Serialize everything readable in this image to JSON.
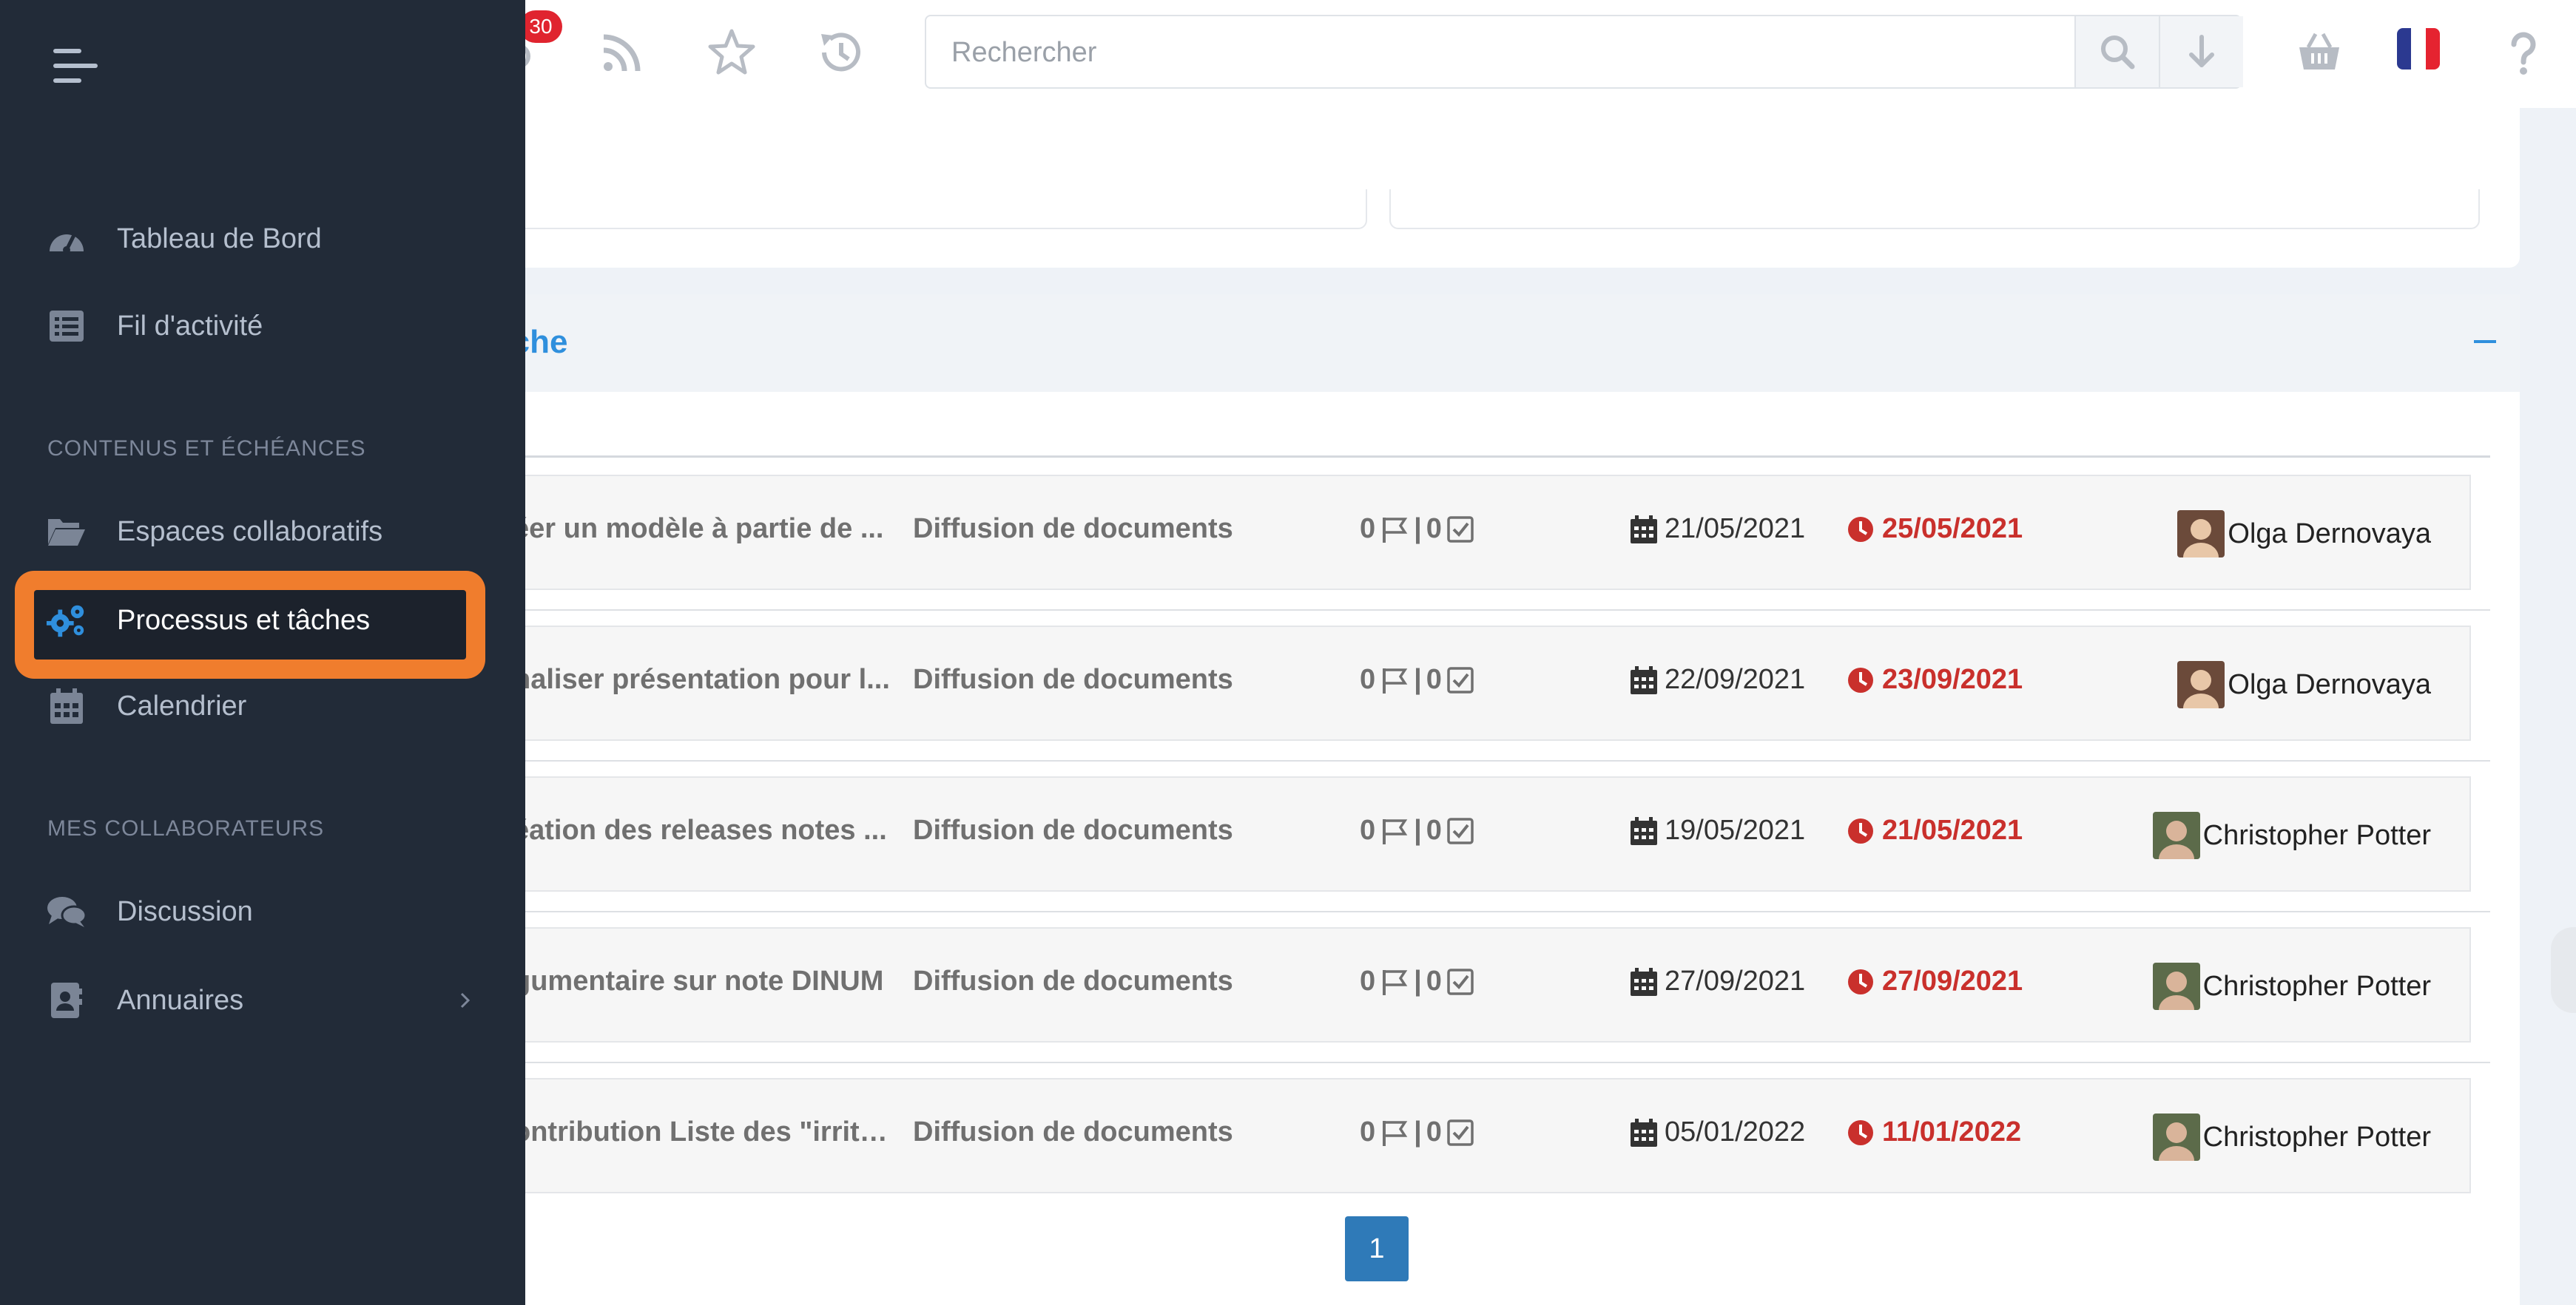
{
  "topbar": {
    "notification_count": "30",
    "search_placeholder": "Rechercher"
  },
  "section": {
    "title": "erche"
  },
  "sidebar": {
    "items_main": [
      {
        "label": "Tableau de Bord",
        "icon": "dashboard-icon"
      },
      {
        "label": "Fil d'activité",
        "icon": "list-icon"
      }
    ],
    "section_content": "CONTENUS ET ÉCHÉANCES",
    "items_content": [
      {
        "label": "Espaces collaboratifs",
        "icon": "folder-open-icon"
      },
      {
        "label": "Processus et tâches",
        "icon": "cogs-icon",
        "active": true
      },
      {
        "label": "Calendrier",
        "icon": "calendar-icon"
      }
    ],
    "section_collab": "MES COLLABORATEURS",
    "items_collab": [
      {
        "label": "Discussion",
        "icon": "comments-icon"
      },
      {
        "label": "Annuaires",
        "icon": "address-book-icon"
      }
    ]
  },
  "tasks": [
    {
      "title": "éer un modèle à partie de ...",
      "space": "Diffusion de documents",
      "flags": "0",
      "checks": "0",
      "start": "21/05/2021",
      "due": "25/05/2021",
      "user": "Olga Dernovaya"
    },
    {
      "title": "naliser présentation pour l...",
      "space": "Diffusion de documents",
      "flags": "0",
      "checks": "0",
      "start": "22/09/2021",
      "due": "23/09/2021",
      "user": "Olga Dernovaya"
    },
    {
      "title": "éation des releases notes ...",
      "space": "Diffusion de documents",
      "flags": "0",
      "checks": "0",
      "start": "19/05/2021",
      "due": "21/05/2021",
      "user": "Christopher Potter"
    },
    {
      "title": "gumentaire sur note DINUM",
      "space": "Diffusion de documents",
      "flags": "0",
      "checks": "0",
      "start": "27/09/2021",
      "due": "27/09/2021",
      "user": "Christopher Potter"
    },
    {
      "title": "ontribution Liste des \"irrita...",
      "space": "Diffusion de documents",
      "flags": "0",
      "checks": "0",
      "start": "05/01/2022",
      "due": "11/01/2022",
      "user": "Christopher Potter"
    }
  ],
  "pagination": {
    "current": "1"
  },
  "colors": {
    "accent": "#2f8fdd",
    "sidebar": "#222b38",
    "highlight": "#f07d2d",
    "due": "#c9302c"
  }
}
